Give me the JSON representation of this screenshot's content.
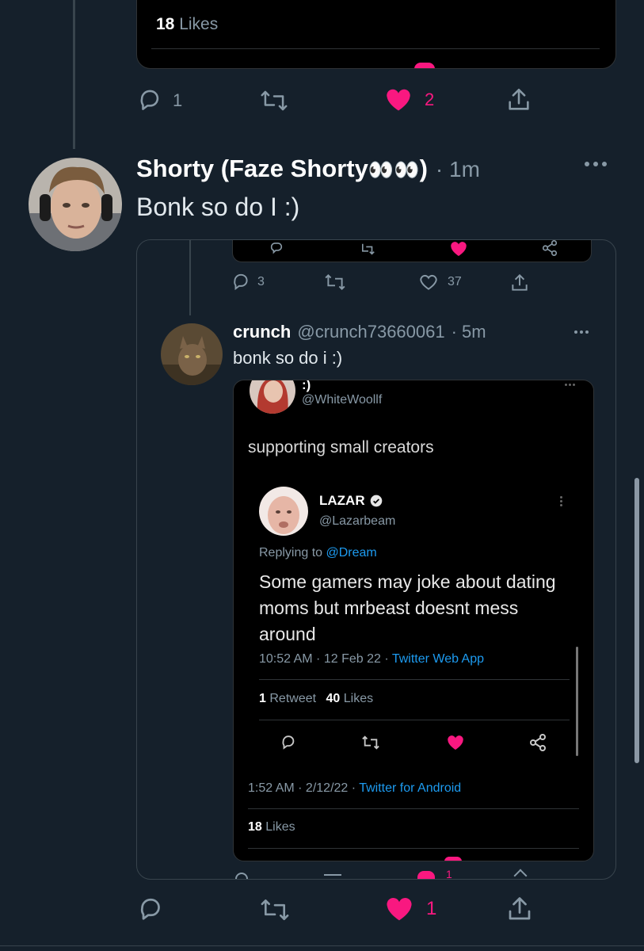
{
  "top": {
    "likes_count": "18",
    "likes_label": "Likes",
    "reply_count": "1",
    "like_count": "2"
  },
  "main_tweet": {
    "display_name": "Shorty (Faze Shorty",
    "emoji": "👀👀",
    "name_close": ")",
    "time": "· 1m",
    "text": "Bonk so do I :)",
    "like_count": "1"
  },
  "quoted_upper": {
    "reply_count": "3",
    "like_count": "37"
  },
  "quoted_tweet": {
    "name": "crunch",
    "handle": "@crunch73660061",
    "time": "· 5m",
    "text": "bonk so do i :)"
  },
  "screenshot": {
    "header_partial": ":)",
    "handle": "@WhiteWoollf",
    "text": "supporting small creators",
    "footer_time": "1:52 AM · 2/12/22 · ",
    "footer_client": "Twitter for Android",
    "likes_count": "18",
    "likes_label": "Likes",
    "partial_like": "1"
  },
  "lazar": {
    "name": "LAZAR",
    "handle": "@Lazarbeam",
    "replying_prefix": "Replying to ",
    "replying_to": "@Dream",
    "text": "Some gamers may joke about dating moms but mrbeast doesnt mess around",
    "time": "10:52 AM · 12 Feb 22 · ",
    "client": "Twitter Web App",
    "retweets_count": "1",
    "retweets_label": "Retweet",
    "likes_count": "40",
    "likes_label": "Likes"
  },
  "colors": {
    "background": "#15202b",
    "like_pink": "#f91880",
    "link_blue": "#1d9bf0",
    "muted": "#8899a6"
  },
  "icons": [
    "reply-icon",
    "retweet-icon",
    "heart-icon",
    "share-icon",
    "more-icon",
    "verified-icon"
  ]
}
